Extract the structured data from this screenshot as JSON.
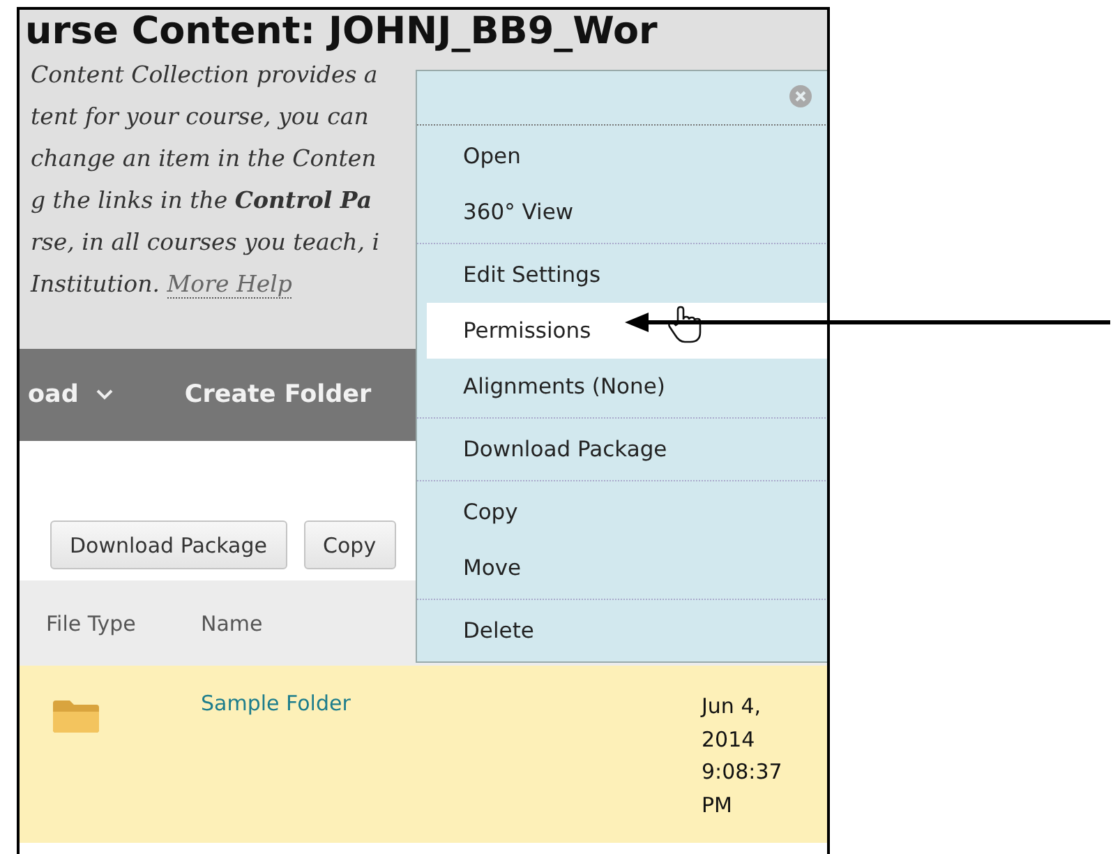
{
  "page_title": "urse Content: JOHNJ_BB9_Wor",
  "description": {
    "lines": [
      "Content Collection provides a",
      "tent for your course, you can",
      "change an item in the Conten",
      "g the links in the **Control Pa**",
      "rse, in all courses you teach, i",
      "Institution."
    ],
    "help_link": "More Help"
  },
  "toolbar": [
    {
      "label": "oad",
      "kind": "dropdown"
    },
    {
      "label": "Create Folder",
      "kind": "plain"
    }
  ],
  "action_buttons": [
    "Download Package",
    "Copy"
  ],
  "table": {
    "columns": [
      "File Type",
      "Name"
    ],
    "rows": [
      {
        "kind": "folder",
        "name": "Sample Folder",
        "date": "Jun 4, 2014 9:08:37 PM"
      }
    ]
  },
  "context_menu": {
    "groups": [
      [
        {
          "label": "Open",
          "selected": false
        },
        {
          "label": "360° View",
          "selected": false
        }
      ],
      [
        {
          "label": "Edit Settings",
          "selected": false
        },
        {
          "label": "Permissions",
          "selected": true
        },
        {
          "label": "Alignments (None)",
          "selected": false
        }
      ],
      [
        {
          "label": "Download Package",
          "selected": false
        }
      ],
      [
        {
          "label": "Copy",
          "selected": false
        },
        {
          "label": "Move",
          "selected": false
        }
      ],
      [
        {
          "label": "Delete",
          "selected": false
        }
      ]
    ]
  }
}
